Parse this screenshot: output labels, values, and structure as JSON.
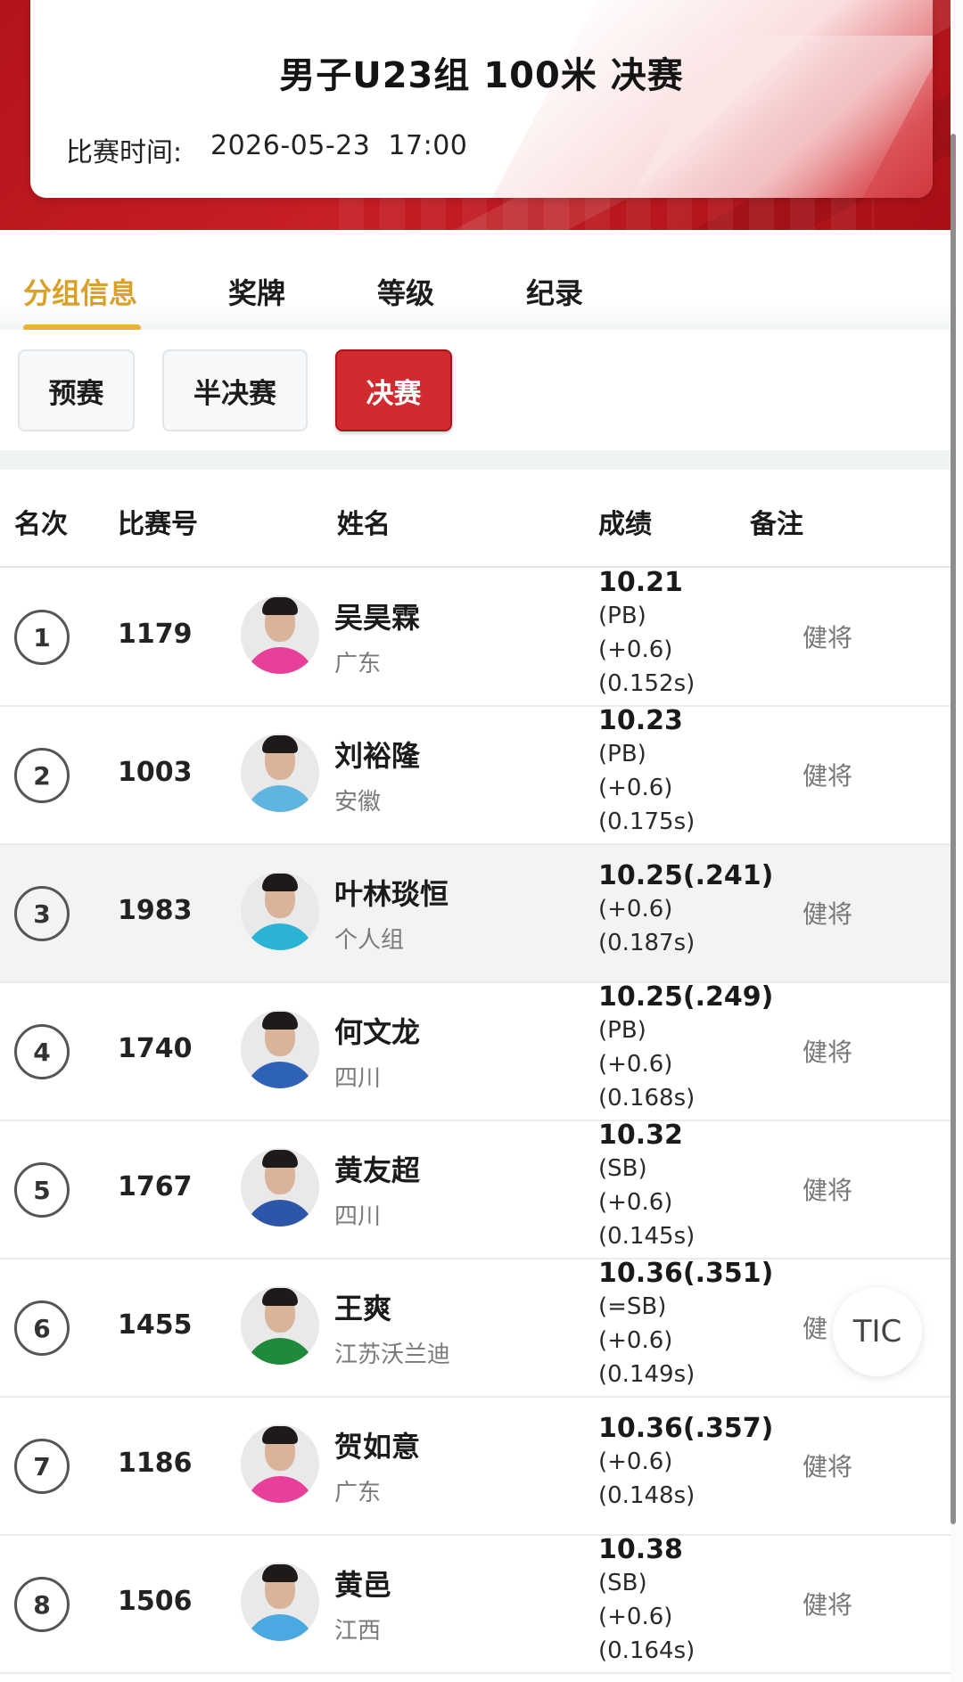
{
  "event": {
    "title": "男子U23组 100米 决赛",
    "time_label": "比赛时间:",
    "time_value": "2026-05-23  17:00"
  },
  "tabs": [
    {
      "label": "分组信息",
      "active": true
    },
    {
      "label": "奖牌",
      "active": false
    },
    {
      "label": "等级",
      "active": false
    },
    {
      "label": "纪录",
      "active": false
    }
  ],
  "rounds": [
    {
      "label": "预赛",
      "active": false
    },
    {
      "label": "半决赛",
      "active": false
    },
    {
      "label": "决赛",
      "active": true
    }
  ],
  "table": {
    "headers": {
      "rank": "名次",
      "bib": "比赛号",
      "name": "姓名",
      "mark": "成绩",
      "remark": "备注"
    },
    "rows": [
      {
        "rank": "1",
        "bib": "1179",
        "name": "吴昊霖",
        "team": "广东",
        "mark": "10.21",
        "details": [
          "(PB)",
          "(+0.6)",
          "(0.152s)"
        ],
        "remark": "健将",
        "kit_color": "#e8409a"
      },
      {
        "rank": "2",
        "bib": "1003",
        "name": "刘裕隆",
        "team": "安徽",
        "mark": "10.23",
        "details": [
          "(PB)",
          "(+0.6)",
          "(0.175s)"
        ],
        "remark": "健将",
        "kit_color": "#5fb4e0"
      },
      {
        "rank": "3",
        "bib": "1983",
        "name": "叶林琰恒",
        "team": "个人组",
        "mark": "10.25(.241)",
        "details": [
          "(+0.6)",
          "(0.187s)"
        ],
        "remark": "健将",
        "kit_color": "#2bb3d6"
      },
      {
        "rank": "4",
        "bib": "1740",
        "name": "何文龙",
        "team": "四川",
        "mark": "10.25(.249)",
        "details": [
          "(PB)",
          "(+0.6)",
          "(0.168s)"
        ],
        "remark": "健将",
        "kit_color": "#2d62b8"
      },
      {
        "rank": "5",
        "bib": "1767",
        "name": "黄友超",
        "team": "四川",
        "mark": "10.32",
        "details": [
          "(SB)",
          "(+0.6)",
          "(0.145s)"
        ],
        "remark": "健将",
        "kit_color": "#2e56a8"
      },
      {
        "rank": "6",
        "bib": "1455",
        "name": "王爽",
        "team": "江苏沃兰迪",
        "mark": "10.36(.351)",
        "details": [
          "(=SB)",
          "(+0.6)",
          "(0.149s)"
        ],
        "remark": "健",
        "kit_color": "#1f8a3c"
      },
      {
        "rank": "7",
        "bib": "1186",
        "name": "贺如意",
        "team": "广东",
        "mark": "10.36(.357)",
        "details": [
          "(+0.6)",
          "(0.148s)"
        ],
        "remark": "健将",
        "kit_color": "#e8409a"
      },
      {
        "rank": "8",
        "bib": "1506",
        "name": "黄邑",
        "team": "江西",
        "mark": "10.38",
        "details": [
          "(SB)",
          "(+0.6)",
          "(0.164s)"
        ],
        "remark": "健将",
        "kit_color": "#4aa9e0"
      }
    ]
  },
  "floating_button": {
    "label": "TIC"
  }
}
